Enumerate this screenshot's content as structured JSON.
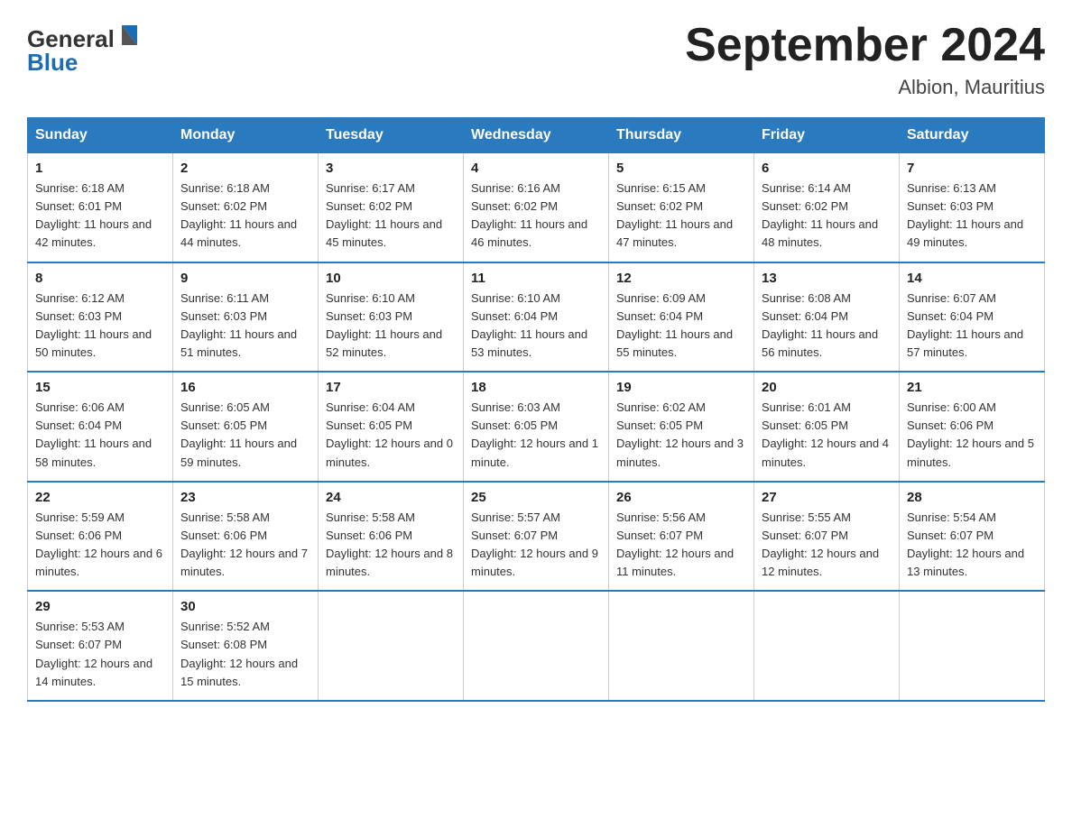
{
  "header": {
    "logo_general": "General",
    "logo_blue": "Blue",
    "title": "September 2024",
    "subtitle": "Albion, Mauritius"
  },
  "days_of_week": [
    "Sunday",
    "Monday",
    "Tuesday",
    "Wednesday",
    "Thursday",
    "Friday",
    "Saturday"
  ],
  "weeks": [
    [
      {
        "day": "1",
        "sunrise": "6:18 AM",
        "sunset": "6:01 PM",
        "daylight": "11 hours and 42 minutes."
      },
      {
        "day": "2",
        "sunrise": "6:18 AM",
        "sunset": "6:02 PM",
        "daylight": "11 hours and 44 minutes."
      },
      {
        "day": "3",
        "sunrise": "6:17 AM",
        "sunset": "6:02 PM",
        "daylight": "11 hours and 45 minutes."
      },
      {
        "day": "4",
        "sunrise": "6:16 AM",
        "sunset": "6:02 PM",
        "daylight": "11 hours and 46 minutes."
      },
      {
        "day": "5",
        "sunrise": "6:15 AM",
        "sunset": "6:02 PM",
        "daylight": "11 hours and 47 minutes."
      },
      {
        "day": "6",
        "sunrise": "6:14 AM",
        "sunset": "6:02 PM",
        "daylight": "11 hours and 48 minutes."
      },
      {
        "day": "7",
        "sunrise": "6:13 AM",
        "sunset": "6:03 PM",
        "daylight": "11 hours and 49 minutes."
      }
    ],
    [
      {
        "day": "8",
        "sunrise": "6:12 AM",
        "sunset": "6:03 PM",
        "daylight": "11 hours and 50 minutes."
      },
      {
        "day": "9",
        "sunrise": "6:11 AM",
        "sunset": "6:03 PM",
        "daylight": "11 hours and 51 minutes."
      },
      {
        "day": "10",
        "sunrise": "6:10 AM",
        "sunset": "6:03 PM",
        "daylight": "11 hours and 52 minutes."
      },
      {
        "day": "11",
        "sunrise": "6:10 AM",
        "sunset": "6:04 PM",
        "daylight": "11 hours and 53 minutes."
      },
      {
        "day": "12",
        "sunrise": "6:09 AM",
        "sunset": "6:04 PM",
        "daylight": "11 hours and 55 minutes."
      },
      {
        "day": "13",
        "sunrise": "6:08 AM",
        "sunset": "6:04 PM",
        "daylight": "11 hours and 56 minutes."
      },
      {
        "day": "14",
        "sunrise": "6:07 AM",
        "sunset": "6:04 PM",
        "daylight": "11 hours and 57 minutes."
      }
    ],
    [
      {
        "day": "15",
        "sunrise": "6:06 AM",
        "sunset": "6:04 PM",
        "daylight": "11 hours and 58 minutes."
      },
      {
        "day": "16",
        "sunrise": "6:05 AM",
        "sunset": "6:05 PM",
        "daylight": "11 hours and 59 minutes."
      },
      {
        "day": "17",
        "sunrise": "6:04 AM",
        "sunset": "6:05 PM",
        "daylight": "12 hours and 0 minutes."
      },
      {
        "day": "18",
        "sunrise": "6:03 AM",
        "sunset": "6:05 PM",
        "daylight": "12 hours and 1 minute."
      },
      {
        "day": "19",
        "sunrise": "6:02 AM",
        "sunset": "6:05 PM",
        "daylight": "12 hours and 3 minutes."
      },
      {
        "day": "20",
        "sunrise": "6:01 AM",
        "sunset": "6:05 PM",
        "daylight": "12 hours and 4 minutes."
      },
      {
        "day": "21",
        "sunrise": "6:00 AM",
        "sunset": "6:06 PM",
        "daylight": "12 hours and 5 minutes."
      }
    ],
    [
      {
        "day": "22",
        "sunrise": "5:59 AM",
        "sunset": "6:06 PM",
        "daylight": "12 hours and 6 minutes."
      },
      {
        "day": "23",
        "sunrise": "5:58 AM",
        "sunset": "6:06 PM",
        "daylight": "12 hours and 7 minutes."
      },
      {
        "day": "24",
        "sunrise": "5:58 AM",
        "sunset": "6:06 PM",
        "daylight": "12 hours and 8 minutes."
      },
      {
        "day": "25",
        "sunrise": "5:57 AM",
        "sunset": "6:07 PM",
        "daylight": "12 hours and 9 minutes."
      },
      {
        "day": "26",
        "sunrise": "5:56 AM",
        "sunset": "6:07 PM",
        "daylight": "12 hours and 11 minutes."
      },
      {
        "day": "27",
        "sunrise": "5:55 AM",
        "sunset": "6:07 PM",
        "daylight": "12 hours and 12 minutes."
      },
      {
        "day": "28",
        "sunrise": "5:54 AM",
        "sunset": "6:07 PM",
        "daylight": "12 hours and 13 minutes."
      }
    ],
    [
      {
        "day": "29",
        "sunrise": "5:53 AM",
        "sunset": "6:07 PM",
        "daylight": "12 hours and 14 minutes."
      },
      {
        "day": "30",
        "sunrise": "5:52 AM",
        "sunset": "6:08 PM",
        "daylight": "12 hours and 15 minutes."
      },
      null,
      null,
      null,
      null,
      null
    ]
  ],
  "labels": {
    "sunrise": "Sunrise:",
    "sunset": "Sunset:",
    "daylight": "Daylight:"
  }
}
